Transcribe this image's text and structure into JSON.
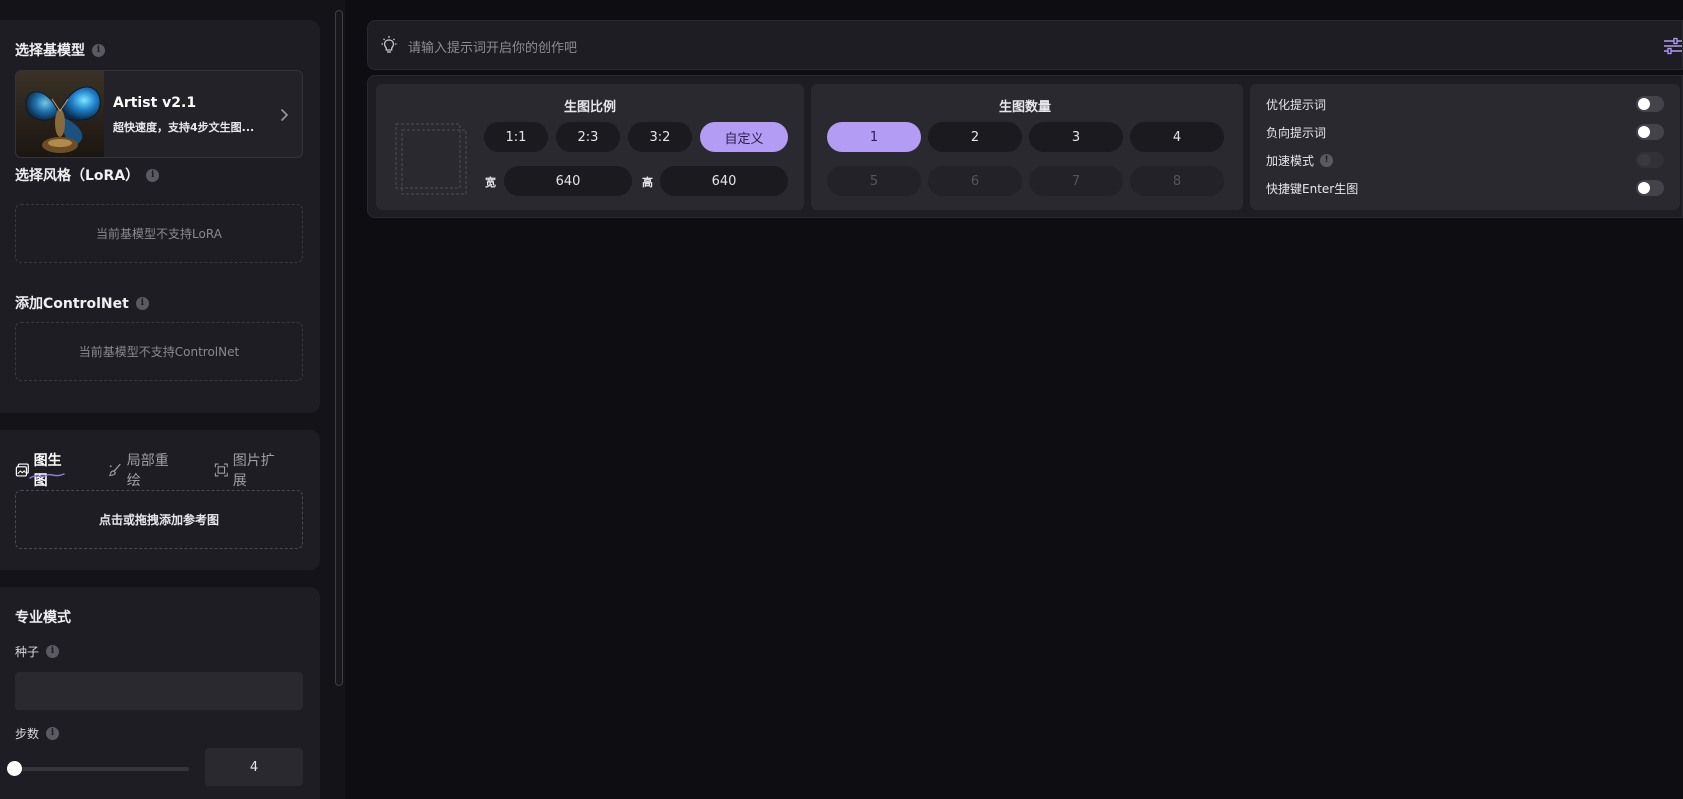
{
  "sidebar": {
    "base_model": {
      "title": "选择基模型",
      "name": "Artist v2.1",
      "desc": "超快速度，支持4步文生图..."
    },
    "lora": {
      "title": "选择风格（LoRA）",
      "empty_text": "当前基模型不支持LoRA"
    },
    "controlnet": {
      "title": "添加ControlNet",
      "empty_text": "当前基模型不支持ControlNet"
    },
    "img_tabs": [
      {
        "label": "图生图",
        "active": true
      },
      {
        "label": "局部重绘",
        "active": false
      },
      {
        "label": "图片扩展",
        "active": false
      }
    ],
    "upload_text": "点击或拖拽添加参考图",
    "pro": {
      "title": "专业模式",
      "seed_label": "种子",
      "steps_label": "步数",
      "steps_value": "4",
      "steps_fraction": 0.0
    }
  },
  "prompt": {
    "placeholder": "请输入提示词开启你的创作吧"
  },
  "ratio": {
    "title": "生图比例",
    "options": [
      "1:1",
      "2:3",
      "3:2",
      "自定义"
    ],
    "selected": "自定义",
    "width_label": "宽",
    "width_value": "640",
    "height_label": "高",
    "height_value": "640"
  },
  "count": {
    "title": "生图数量",
    "options": [
      "1",
      "2",
      "3",
      "4",
      "5",
      "6",
      "7",
      "8"
    ],
    "selected": "1"
  },
  "toggles": [
    {
      "label": "优化提示词",
      "on": false,
      "disabled": false
    },
    {
      "label": "负向提示词",
      "on": false,
      "disabled": false
    },
    {
      "label": "加速模式",
      "on": false,
      "disabled": true
    },
    {
      "label": "快捷键Enter生图",
      "on": false,
      "disabled": false
    }
  ],
  "colors": {
    "accent": "#b39cf4",
    "background": "#0e0d12",
    "panel": "#1e1d23"
  }
}
